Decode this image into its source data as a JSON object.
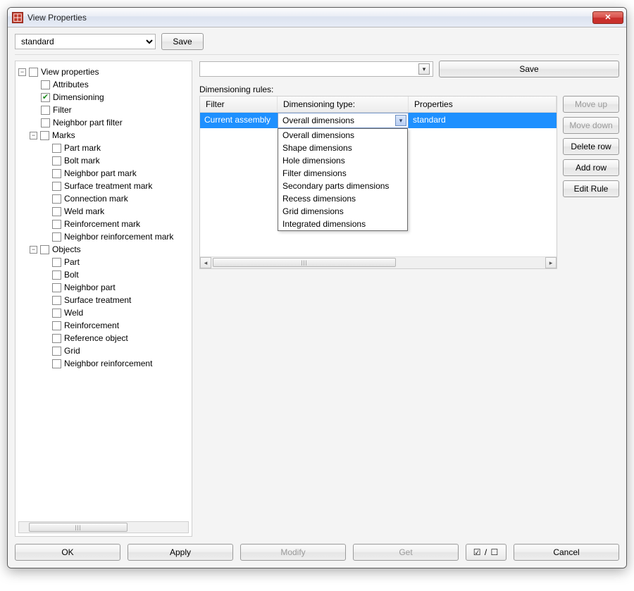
{
  "window": {
    "title": "View Properties"
  },
  "presetCombo": {
    "value": "standard"
  },
  "buttons": {
    "save_small": "Save",
    "save_big": "Save",
    "move_up": "Move up",
    "move_down": "Move down",
    "delete_row": "Delete row",
    "add_row": "Add row",
    "edit_rule": "Edit Rule",
    "ok": "OK",
    "apply": "Apply",
    "modify": "Modify",
    "get": "Get",
    "cancel": "Cancel",
    "toggle_icons": "☑ / ☐"
  },
  "tree": {
    "root": {
      "label": "View properties",
      "children": {
        "attributes": "Attributes",
        "dimensioning": "Dimensioning",
        "filter": "Filter",
        "neighbor_part_filter": "Neighbor part filter",
        "marks": {
          "label": "Marks",
          "children": {
            "part_mark": "Part mark",
            "bolt_mark": "Bolt mark",
            "neighbor_part_mark": "Neighbor part mark",
            "surface_treatment_mark": "Surface treatment mark",
            "connection_mark": "Connection mark",
            "weld_mark": "Weld mark",
            "reinforcement_mark": "Reinforcement mark",
            "neighbor_reinforcement_mark": "Neighbor reinforcement mark"
          }
        },
        "objects": {
          "label": "Objects",
          "children": {
            "part": "Part",
            "bolt": "Bolt",
            "neighbor_part": "Neighbor part",
            "surface_treatment": "Surface treatment",
            "weld": "Weld",
            "reinforcement": "Reinforcement",
            "reference_object": "Reference object",
            "grid": "Grid",
            "neighbor_reinforcement": "Neighbor reinforcement"
          }
        }
      }
    }
  },
  "rules": {
    "section_label": "Dimensioning rules:",
    "headers": {
      "filter": "Filter",
      "type": "Dimensioning type:",
      "properties": "Properties"
    },
    "row": {
      "filter": "Current assembly",
      "type_value": "Overall dimensions",
      "properties": "standard"
    },
    "type_options": [
      "Overall dimensions",
      "Shape dimensions",
      "Hole dimensions",
      "Filter dimensions",
      "Secondary parts dimensions",
      "Recess dimensions",
      "Grid dimensions",
      "Integrated dimensions"
    ]
  }
}
